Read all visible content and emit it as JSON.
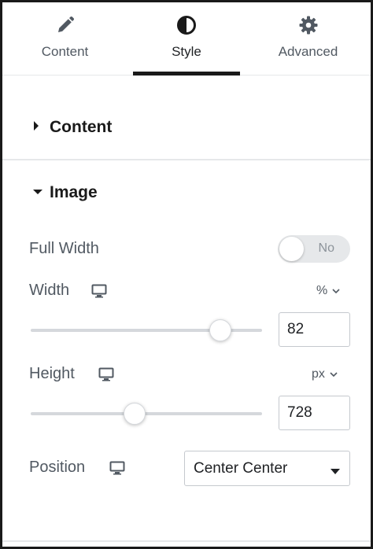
{
  "tabs": [
    {
      "label": "Content",
      "icon": "pencil-icon",
      "active": false
    },
    {
      "label": "Style",
      "icon": "half-circle-icon",
      "active": true
    },
    {
      "label": "Advanced",
      "icon": "gear-icon",
      "active": false
    }
  ],
  "sections": {
    "content": {
      "title": "Content",
      "expanded": false
    },
    "image": {
      "title": "Image",
      "expanded": true
    }
  },
  "controls": {
    "full_width": {
      "label": "Full Width",
      "toggle_text": "No",
      "on": false
    },
    "width": {
      "label": "Width",
      "device_icon": "desktop-icon",
      "unit": "%",
      "value": "82",
      "slider_fraction": 0.82
    },
    "height": {
      "label": "Height",
      "device_icon": "desktop-icon",
      "unit": "px",
      "value": "728",
      "slider_fraction": 0.45
    },
    "position": {
      "label": "Position",
      "device_icon": "desktop-icon",
      "value": "Center Center"
    }
  },
  "colors": {
    "text_dark": "#1f2124",
    "text_muted": "#515962",
    "border": "#c5c9ce",
    "track": "#d5d8dc",
    "toggle_bg": "#e6e8ea"
  }
}
